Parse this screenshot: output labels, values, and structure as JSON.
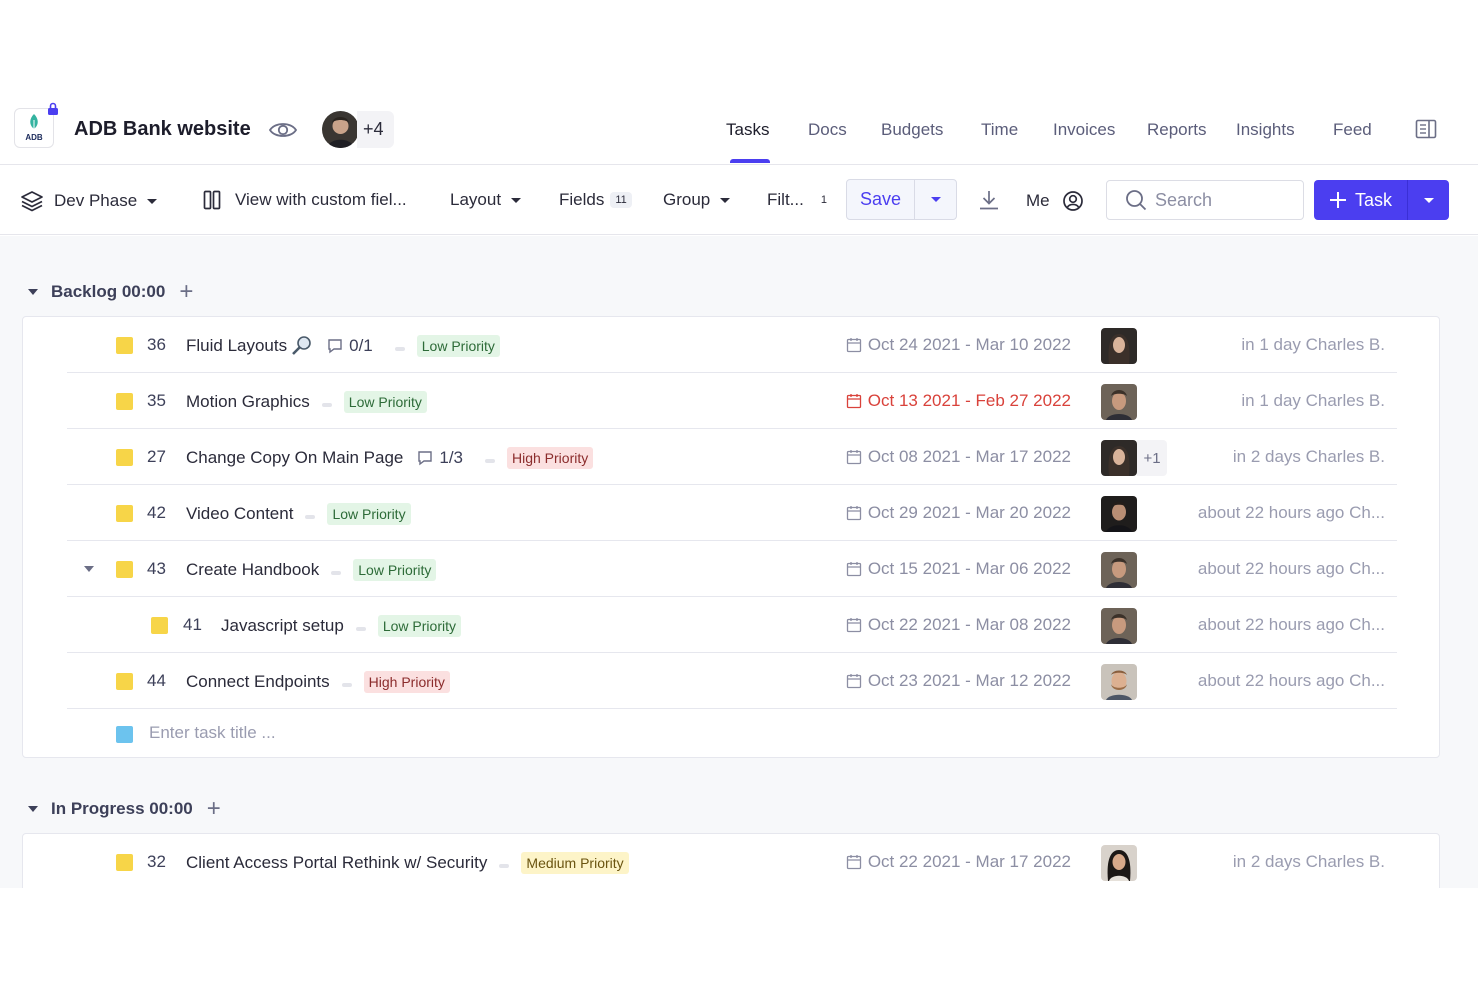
{
  "header": {
    "logo_text": "ADB",
    "project_title": "ADB Bank website",
    "members_extra": "+4",
    "tabs": [
      {
        "label": "Tasks",
        "active": true
      },
      {
        "label": "Docs"
      },
      {
        "label": "Budgets"
      },
      {
        "label": "Time"
      },
      {
        "label": "Invoices"
      },
      {
        "label": "Reports"
      },
      {
        "label": "Insights"
      },
      {
        "label": "Feed"
      }
    ]
  },
  "toolbar": {
    "phase_label": "Dev Phase",
    "view_label": "View with custom fiel...",
    "layout_label": "Layout",
    "fields_label": "Fields",
    "fields_count": "11",
    "group_label": "Group",
    "filter_label": "Filt...",
    "filter_count": "1",
    "save_label": "Save",
    "me_label": "Me",
    "search_placeholder": "Search",
    "task_button_label": "Task"
  },
  "groups": [
    {
      "name": "Backlog 00:00",
      "tasks": [
        {
          "id": "36",
          "title": "Fluid Layouts",
          "subtasks": "0/1",
          "priority": "Low Priority",
          "priority_level": "low",
          "dates": "Oct 24 2021 - Mar 10 2022",
          "overdue": false,
          "updated": "in 1 day Charles B."
        },
        {
          "id": "35",
          "title": "Motion Graphics",
          "subtasks": "",
          "priority": "Low Priority",
          "priority_level": "low",
          "dates": "Oct 13 2021 - Feb 27 2022",
          "overdue": true,
          "updated": "in 1 day Charles B."
        },
        {
          "id": "27",
          "title": "Change Copy On Main Page",
          "subtasks": "1/3",
          "priority": "High Priority",
          "priority_level": "high",
          "dates": "Oct 08 2021 - Mar 17 2022",
          "overdue": false,
          "assignee_extra": "+1",
          "updated": "in 2 days Charles B."
        },
        {
          "id": "42",
          "title": "Video Content",
          "subtasks": "",
          "priority": "Low Priority",
          "priority_level": "low",
          "dates": "Oct 29 2021 - Mar 20 2022",
          "overdue": false,
          "updated": "about 22 hours ago Ch..."
        },
        {
          "id": "43",
          "title": "Create Handbook",
          "subtasks": "",
          "priority": "Low Priority",
          "priority_level": "low",
          "dates": "Oct 15 2021 - Mar 06 2022",
          "overdue": false,
          "updated": "about 22 hours ago Ch..."
        },
        {
          "id": "41",
          "title": "Javascript setup",
          "subtasks": "",
          "priority": "Low Priority",
          "priority_level": "low",
          "dates": "Oct 22 2021 - Mar 08 2022",
          "overdue": false,
          "updated": "about 22 hours ago Ch..."
        },
        {
          "id": "44",
          "title": "Connect Endpoints",
          "subtasks": "",
          "priority": "High Priority",
          "priority_level": "high",
          "dates": "Oct 23 2021 - Mar 12 2022",
          "overdue": false,
          "updated": "about 22 hours ago Ch..."
        }
      ],
      "new_task_placeholder": "Enter task title ..."
    },
    {
      "name": "In Progress 00:00",
      "tasks": [
        {
          "id": "32",
          "title": "Client Access Portal Rethink w/ Security",
          "subtasks": "",
          "priority": "Medium Priority",
          "priority_level": "medium",
          "dates": "Oct 22 2021 - Mar 17 2022",
          "overdue": false,
          "updated": "in 2 days Charles B."
        }
      ]
    }
  ],
  "colors": {
    "accent": "#4b3ef0",
    "task_square": "#f7d548",
    "new_task_square": "#6cc3ee",
    "overdue": "#d9423b"
  }
}
